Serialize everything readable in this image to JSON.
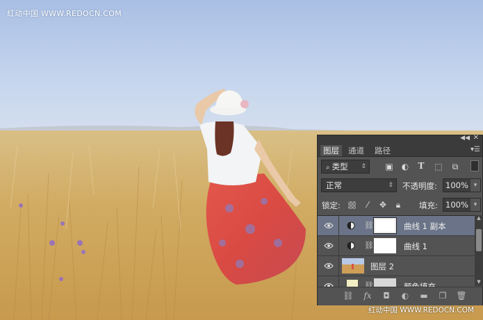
{
  "watermark": {
    "top": "红动中国 WWW.REDOCN.COM",
    "bottom": "红动中国 WWW.REDOCN.COM"
  },
  "layers_panel": {
    "tabs": [
      {
        "label": "图层",
        "active": true
      },
      {
        "label": "通道",
        "active": false
      },
      {
        "label": "路径",
        "active": false
      }
    ],
    "filter_kind": "类型",
    "filter_icons": [
      "image-filter-icon",
      "adjustment-filter-icon",
      "type-filter-icon",
      "shape-filter-icon",
      "smart-object-filter-icon"
    ],
    "blend_mode": "正常",
    "opacity_label": "不透明度:",
    "opacity_value": "100%",
    "lock_label": "锁定:",
    "fill_label": "填充:",
    "fill_value": "100%",
    "layers": [
      {
        "name": "曲线 1 副本",
        "type": "curves-adjustment",
        "selected": true,
        "visible": true
      },
      {
        "name": "曲线 1",
        "type": "curves-adjustment",
        "selected": false,
        "visible": true
      },
      {
        "name": "图层 2",
        "type": "pixel",
        "selected": false,
        "visible": true
      },
      {
        "name": "颜色填充",
        "type": "fill",
        "selected": false,
        "visible": true
      }
    ],
    "bottom_icons": [
      "link-layers-icon",
      "fx-icon",
      "add-mask-icon",
      "new-adjustment-icon",
      "new-group-icon",
      "new-layer-icon",
      "delete-icon"
    ],
    "colors": {
      "panel": "#535353",
      "selected": "#6a7387",
      "header": "#3b3b3b"
    }
  }
}
